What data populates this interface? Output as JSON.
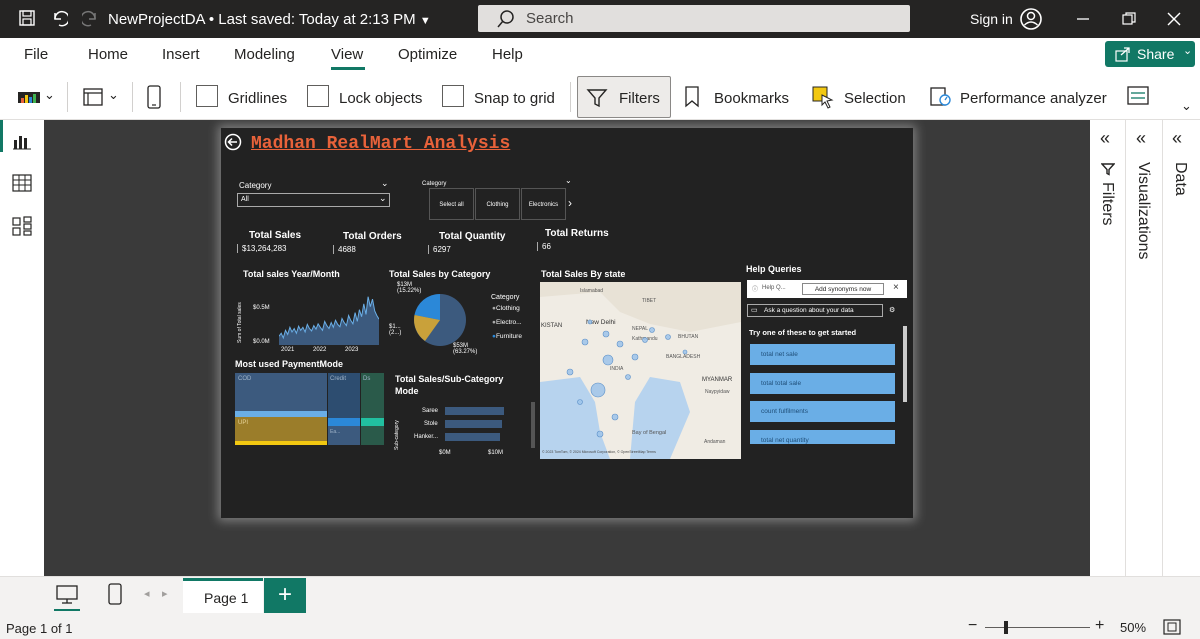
{
  "titlebar": {
    "title": "NewProjectDA",
    "saved": "• Last saved: Today at 2:13 PM",
    "search_label": "Search",
    "signin": "Sign in"
  },
  "menu": {
    "items": [
      "File",
      "Home",
      "Insert",
      "Modeling",
      "View",
      "Optimize",
      "Help"
    ],
    "share": "Share"
  },
  "ribbon": {
    "gridlines": "Gridlines",
    "lock_objects": "Lock objects",
    "snap_to_grid": "Snap to grid",
    "filters": "Filters",
    "bookmarks": "Bookmarks",
    "selection": "Selection",
    "performance_analyzer": "Performance analyzer"
  },
  "report": {
    "title": "Madhan RealMart Analysis",
    "slicer1": {
      "label": "Category",
      "value": "All"
    },
    "slicer2": {
      "label": "Category",
      "buttons": [
        "Select all",
        "Clothing",
        "Electronics"
      ]
    },
    "kpis": [
      {
        "label": "Total Sales",
        "value": "$13,264,283"
      },
      {
        "label": "Total Orders",
        "value": "4688"
      },
      {
        "label": "Total Quantity",
        "value": "6297"
      },
      {
        "label": "Total Returns",
        "value": "66"
      }
    ],
    "line_chart": {
      "title": "Total sales Year/Month",
      "ylabel": "Sum of Total sales",
      "yticks": [
        "$0.5M",
        "$0.0M"
      ],
      "xticks": [
        "2021",
        "2022",
        "2023"
      ],
      "values": [
        0.15,
        0.2,
        0.12,
        0.25,
        0.18,
        0.3,
        0.22,
        0.28,
        0.2,
        0.32,
        0.25,
        0.3,
        0.22,
        0.35,
        0.28,
        0.24,
        0.33,
        0.27,
        0.36,
        0.3,
        0.25,
        0.4,
        0.33,
        0.28,
        0.38,
        0.3,
        0.42,
        0.35,
        0.31,
        0.45,
        0.38,
        0.33,
        0.5,
        0.42,
        0.36,
        0.55,
        0.4,
        0.6,
        0.48,
        0.7,
        0.52,
        0.82,
        0.65,
        0.78,
        0.58,
        0.5,
        0.44
      ]
    },
    "pie_chart": {
      "title": "Total Sales by Category",
      "legend_title": "Category",
      "legend": [
        "Clothing",
        "Electro...",
        "Furniture"
      ],
      "labels": [
        "$13M\n(15.22%)",
        "$1...\n(2...)",
        "$53M\n(63.27%)"
      ]
    },
    "map": {
      "title": "Total Sales By state",
      "labels": [
        "Islamabad",
        "TIBET",
        "KISTAN",
        "New Delhi",
        "NEPAL",
        "Kathmandu",
        "BHUTAN",
        "BANGLADESH",
        "INDIA",
        "MYANMAR",
        "Naypyidaw",
        "Bay of Bengal",
        "Andaman"
      ],
      "attribution": "© 2023 TomTom, © 2024 Microsoft Corporation, © OpenStreetMap Terms"
    },
    "help_queries": {
      "title": "Help Queries",
      "input": "Help Q...",
      "add_synonyms": "Add synonyms now",
      "ask": "Ask a question about your data",
      "try_text": "Try one of these to get started",
      "suggestions": [
        "total net sale",
        "total total sale",
        "count fulfilments",
        "total net quantity"
      ]
    },
    "treemap": {
      "title": "Most used PaymentMode",
      "labels": [
        "COD",
        "Credit",
        "Ds",
        "UPI",
        "Ea..."
      ]
    },
    "bar_chart": {
      "title": "Total Sales/Sub-Category Mode",
      "ylabel": "Sub-category",
      "categories": [
        "Saree",
        "Stole",
        "Hanker..."
      ],
      "xticks": [
        "$0M",
        "$10M"
      ]
    }
  },
  "panels": {
    "filters": "Filters",
    "visualizations": "Visualizations",
    "data": "Data"
  },
  "pages": {
    "tab": "Page 1",
    "add": "+"
  },
  "status": {
    "page": "Page 1 of 1",
    "zoom": "50%"
  }
}
